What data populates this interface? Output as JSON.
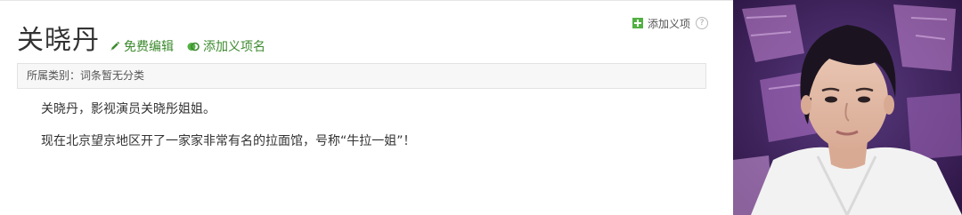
{
  "entry": {
    "title": "关晓丹",
    "edit_label": "免费编辑",
    "add_name_label": "添加义项名",
    "add_definition_label": "添加义项",
    "help_symbol": "?"
  },
  "category": {
    "label": "所属类别：",
    "value": "词条暂无分类"
  },
  "body": {
    "paragraphs": [
      "关晓丹，影视演员关晓彤姐姐。",
      "现在北京望京地区开了一家家非常有名的拉面馆，号称“牛拉一姐”！"
    ]
  },
  "colors": {
    "action_green": "#3c8a2e",
    "plus_green": "#52b043"
  },
  "photo": {
    "icon": "portrait-photo"
  }
}
